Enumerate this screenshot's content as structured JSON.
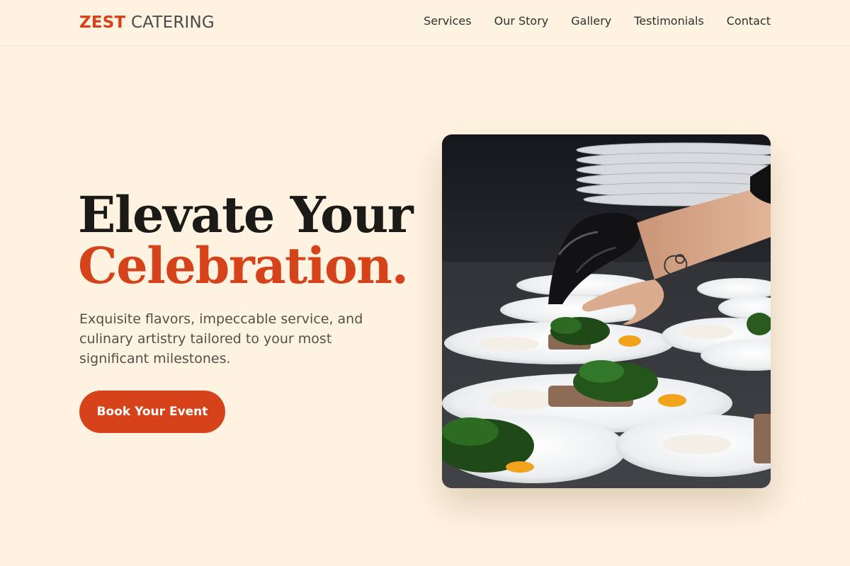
{
  "brand": {
    "name_strong": "ZEST",
    "name_light": "CATERING"
  },
  "nav": {
    "items": [
      {
        "label": "Services"
      },
      {
        "label": "Our Story"
      },
      {
        "label": "Gallery"
      },
      {
        "label": "Testimonials"
      },
      {
        "label": "Contact"
      }
    ]
  },
  "hero": {
    "title_line1": "Elevate Your",
    "title_line2": "Celebration.",
    "subtitle": "Exquisite flavors, impeccable service, and culinary artistry tailored to your most significant milestones.",
    "cta_label": "Book Your Event",
    "image": {
      "description_icon": "plated-dishes-photo"
    }
  },
  "colors": {
    "accent": "#d64219",
    "background": "#fef2e1",
    "heading": "#1c1a17",
    "body_text": "#555049"
  }
}
